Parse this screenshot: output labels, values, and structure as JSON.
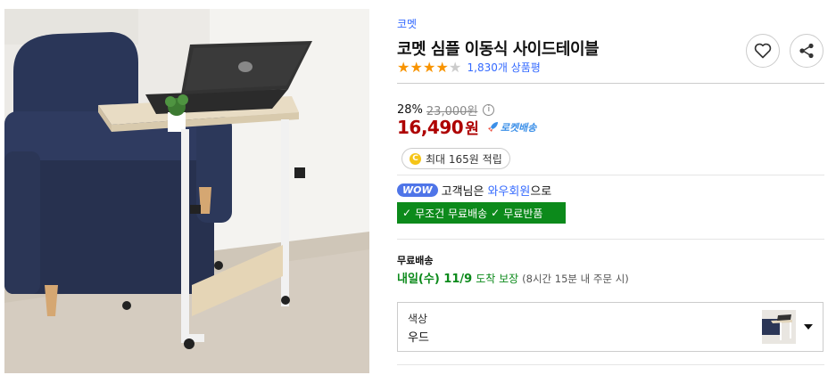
{
  "product": {
    "brand": "코멧",
    "title": "코멧 심플 이동식 사이드테이블",
    "rating": 4,
    "rating_max": 5,
    "review_count": "1,830개 상품평",
    "image_alt": "laptop side table beside navy sofa"
  },
  "actions": {
    "wishlist_icon": "heart-icon",
    "share_icon": "share-icon"
  },
  "price": {
    "discount_rate": "28%",
    "original_price": "23,000원",
    "sale_price": "16,490",
    "currency": "원",
    "rocket_label": "로켓배송"
  },
  "cashback": {
    "coin_label": "C",
    "text": "최대 165원 적립"
  },
  "wow": {
    "badge": "WOW",
    "text_before": "고객님은",
    "member_text": "와우회원",
    "text_after": "으로",
    "benefit1": "무조건 무료배송",
    "benefit2": "무료반품"
  },
  "shipping": {
    "title": "무료배송",
    "date": "내일(수) 11/9",
    "guarantee": "도착 보장",
    "note": "(8시간 15분 내 주문 시)"
  },
  "option": {
    "label": "색상",
    "value": "우드"
  },
  "colors": {
    "price_red": "#ae0000",
    "link_blue": "#346aff",
    "benefit_green": "#0c8a1b",
    "star_orange": "#f89400"
  }
}
